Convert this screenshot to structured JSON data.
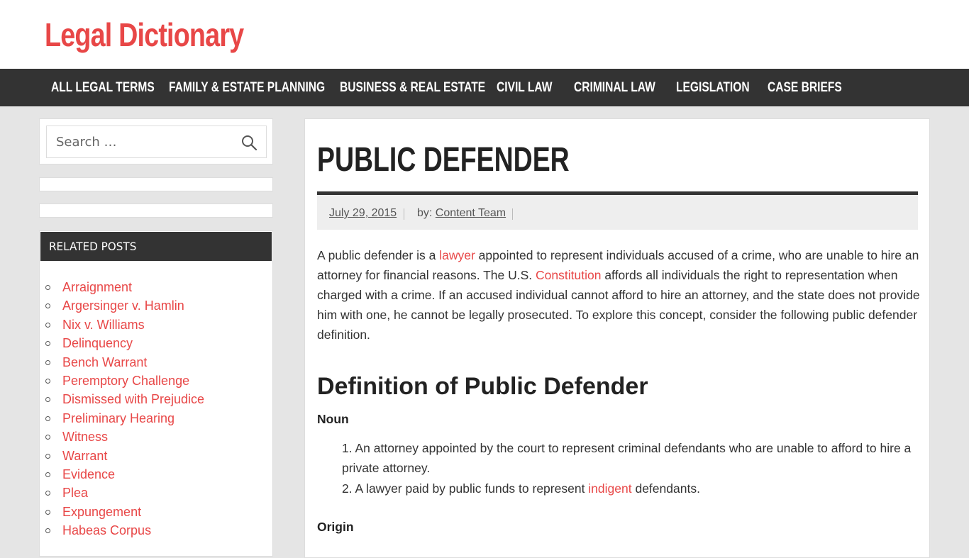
{
  "site": {
    "title": "Legal Dictionary"
  },
  "nav": {
    "items": [
      "ALL LEGAL TERMS",
      "FAMILY & ESTATE PLANNING",
      "BUSINESS & REAL ESTATE",
      "CIVIL LAW",
      "CRIMINAL LAW",
      "LEGISLATION",
      "CASE BRIEFS"
    ]
  },
  "search": {
    "placeholder": "Search …"
  },
  "sidebar": {
    "related_title": "RELATED POSTS",
    "related": [
      "Arraignment",
      "Argersinger v. Hamlin",
      "Nix v. Williams",
      "Delinquency",
      "Bench Warrant",
      "Peremptory Challenge",
      "Dismissed with Prejudice",
      "Preliminary Hearing",
      "Witness",
      "Warrant",
      "Evidence",
      "Plea",
      "Expungement",
      "Habeas Corpus"
    ]
  },
  "article": {
    "title": "PUBLIC DEFENDER",
    "date": "July 29, 2015",
    "by_label": "by:",
    "author": "Content Team",
    "intro_1": "A public defender is a ",
    "intro_link_1": "lawyer",
    "intro_2": " appointed to represent individuals accused of a crime, who are unable to hire an attorney for financial reasons. The U.S. ",
    "intro_link_2": "Constitution",
    "intro_3": " affords all individuals the right to representation when charged with a crime. If an accused individual cannot afford to hire an attorney, and the state does not provide him with one, he cannot be legally prosecuted. To explore this concept, consider the following public defender definition.",
    "definition_heading": "Definition of Public Defender",
    "noun_label": "Noun",
    "def_1": "1. An attorney appointed by the court to represent criminal defendants who are unable to afford to hire a private attorney.",
    "def_2_a": "2. A lawyer paid by public funds to represent ",
    "def_2_link": "indigent",
    "def_2_b": " defendants.",
    "origin_label": "Origin"
  },
  "colors": {
    "accent": "#e84747",
    "nav_bg": "#333333",
    "page_bg": "#e5e5e5"
  }
}
